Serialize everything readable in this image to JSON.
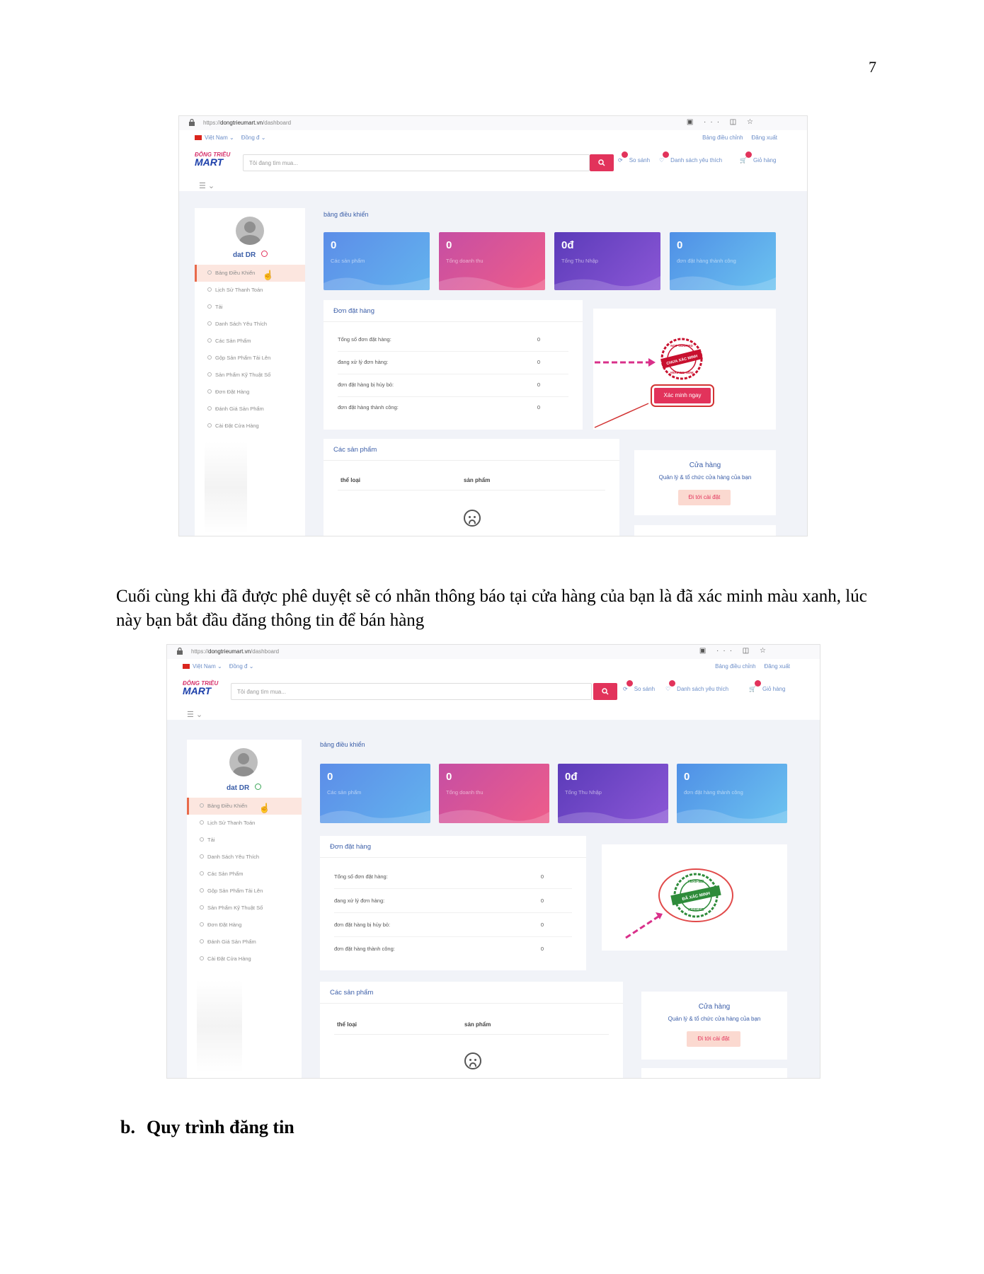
{
  "page_number": "7",
  "paragraph": "Cuối cùng khi đã được phê duyệt sẽ có nhãn thông báo tại cửa hàng của bạn là đã xác minh màu xanh, lúc này bạn bắt đầu đăng thông tin để bán hàng",
  "heading": {
    "label": "b.",
    "text": "Quy trình đăng tin"
  },
  "screens": [
    {
      "url_host": "dongtrieumart.vn",
      "url_scheme": "https://",
      "url_path": "/dashboard",
      "lang": "Việt Nam",
      "currency": "Đồng đ",
      "top_links": [
        "Bảng điều chỉnh",
        "Đăng xuất"
      ],
      "logo_line1": "ĐÔNG TRIỀU",
      "logo_line2": "MART",
      "search_placeholder": "Tôi đang tìm mua...",
      "compare_label": "So sánh",
      "wishlist_label": "Danh sách yêu thích",
      "cart_label": "Giỏ hàng",
      "user_name": "dat DR",
      "menu": [
        "Bảng Điều Khiển",
        "Lịch Sử Thanh Toán",
        "Tải",
        "Danh Sách Yêu Thích",
        "Các Sản Phẩm",
        "Gộp Sản Phẩm Tải Lên",
        "Sản Phẩm Kỹ Thuật Số",
        "Đơn Đặt Hàng",
        "Đánh Giá Sản Phẩm",
        "Cài Đặt Cửa Hàng"
      ],
      "breadcrumb": "bảng điều khiển",
      "cards": [
        {
          "value": "0",
          "label": "Các sản phẩm"
        },
        {
          "value": "0",
          "label": "Tổng doanh thu"
        },
        {
          "value": "0đ",
          "label": "Tổng Thu Nhập"
        },
        {
          "value": "0",
          "label": "đơn đặt hàng thành công"
        }
      ],
      "orders_title": "Đơn đặt hàng",
      "orders": [
        {
          "label": "Tổng số đơn đặt hàng:",
          "value": "0"
        },
        {
          "label": "đang xử lý đơn hàng:",
          "value": "0"
        },
        {
          "label": "đơn đặt hàng bị hủy bỏ:",
          "value": "0"
        },
        {
          "label": "đơn đặt hàng thành công:",
          "value": "0"
        }
      ],
      "products_title": "Các sản phẩm",
      "col_category": "thể loại",
      "col_product": "sản phẩm",
      "store_title": "Cửa hàng",
      "store_desc": "Quản lý & tổ chức cửa hàng của bạn",
      "store_button": "Đi tới cài đặt",
      "stamp_top": "NOT VERIFIED",
      "stamp_text": "CHƯA XÁC MINH",
      "stamp_bottom": "VERIFIED NOW",
      "verify_button": "Xác minh ngay"
    },
    {
      "url_host": "dongtrieumart.vn",
      "url_scheme": "https://",
      "url_path": "/dashboard",
      "lang": "Việt Nam",
      "currency": "Đồng đ",
      "top_links": [
        "Bảng điều chỉnh",
        "Đăng xuất"
      ],
      "logo_line1": "ĐÔNG TRIỀU",
      "logo_line2": "MART",
      "search_placeholder": "Tôi đang tìm mua...",
      "compare_label": "So sánh",
      "wishlist_label": "Danh sách yêu thích",
      "cart_label": "Giỏ hàng",
      "user_name": "dat DR",
      "menu": [
        "Bảng Điều Khiển",
        "Lịch Sử Thanh Toán",
        "Tải",
        "Danh Sách Yêu Thích",
        "Các Sản Phẩm",
        "Gộp Sản Phẩm Tải Lên",
        "Sản Phẩm Kỹ Thuật Số",
        "Đơn Đặt Hàng",
        "Đánh Giá Sản Phẩm",
        "Cài Đặt Cửa Hàng"
      ],
      "breadcrumb": "bảng điều khiển",
      "cards": [
        {
          "value": "0",
          "label": "Các sản phẩm"
        },
        {
          "value": "0",
          "label": "Tổng doanh thu"
        },
        {
          "value": "0đ",
          "label": "Tổng Thu Nhập"
        },
        {
          "value": "0",
          "label": "đơn đặt hàng thành công"
        }
      ],
      "orders_title": "Đơn đặt hàng",
      "orders": [
        {
          "label": "Tổng số đơn đặt hàng:",
          "value": "0"
        },
        {
          "label": "đang xử lý đơn hàng:",
          "value": "0"
        },
        {
          "label": "đơn đặt hàng bị hủy bỏ:",
          "value": "0"
        },
        {
          "label": "đơn đặt hàng thành công:",
          "value": "0"
        }
      ],
      "products_title": "Các sản phẩm",
      "col_category": "thể loại",
      "col_product": "sản phẩm",
      "store_title": "Cửa hàng",
      "store_desc": "Quản lý & tổ chức cửa hàng của bạn",
      "store_button": "Đi tới cài đặt",
      "stamp_top": "VERIFIED",
      "stamp_text": "ĐÃ XÁC MINH",
      "stamp_bottom": "VERIFIED"
    }
  ]
}
